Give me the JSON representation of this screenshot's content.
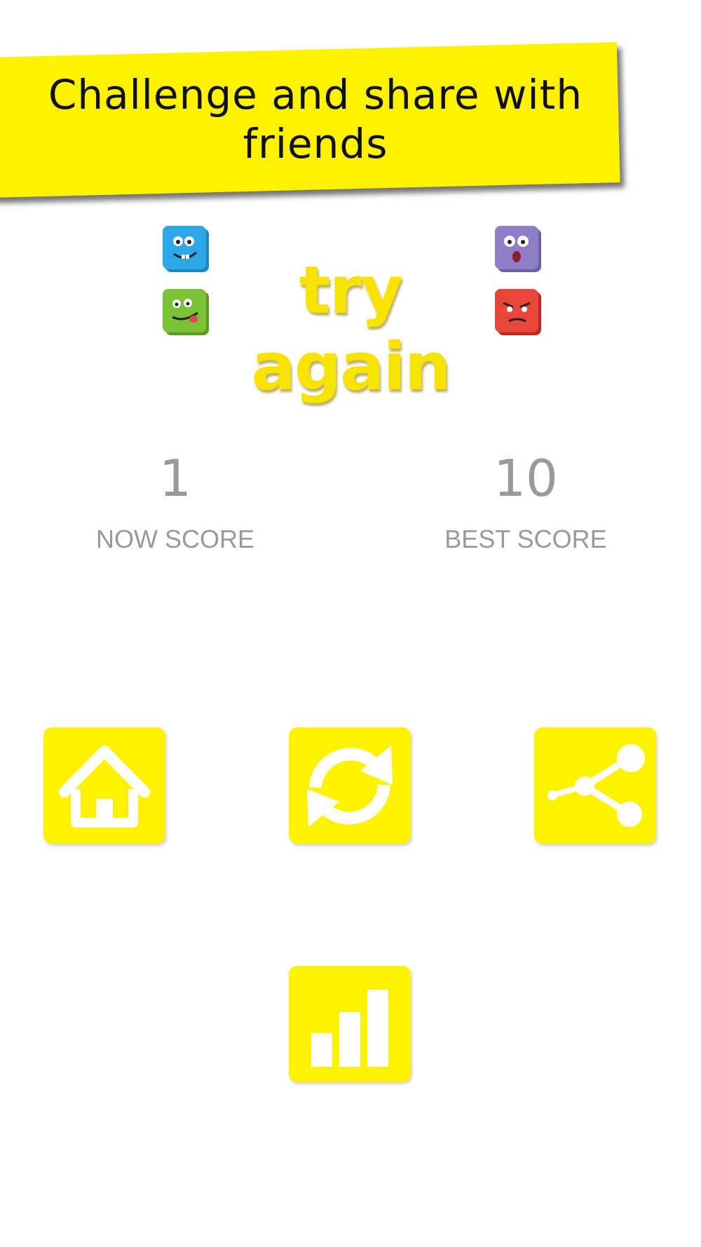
{
  "banner": {
    "line1": "Challenge and share with",
    "line2": "friends"
  },
  "logo": {
    "text": "try again"
  },
  "scores": {
    "now": {
      "value": "1",
      "label": "NOW SCORE"
    },
    "best": {
      "value": "10",
      "label": "BEST SCORE"
    }
  },
  "buttons": {
    "home": {
      "icon": "home-icon"
    },
    "restart": {
      "icon": "refresh-icon"
    },
    "share": {
      "icon": "share-icon"
    },
    "leaderboard": {
      "icon": "bar-chart-icon"
    }
  },
  "colors": {
    "accent": "#fff200",
    "score_text": "#999999",
    "banner_text": "#111111"
  }
}
